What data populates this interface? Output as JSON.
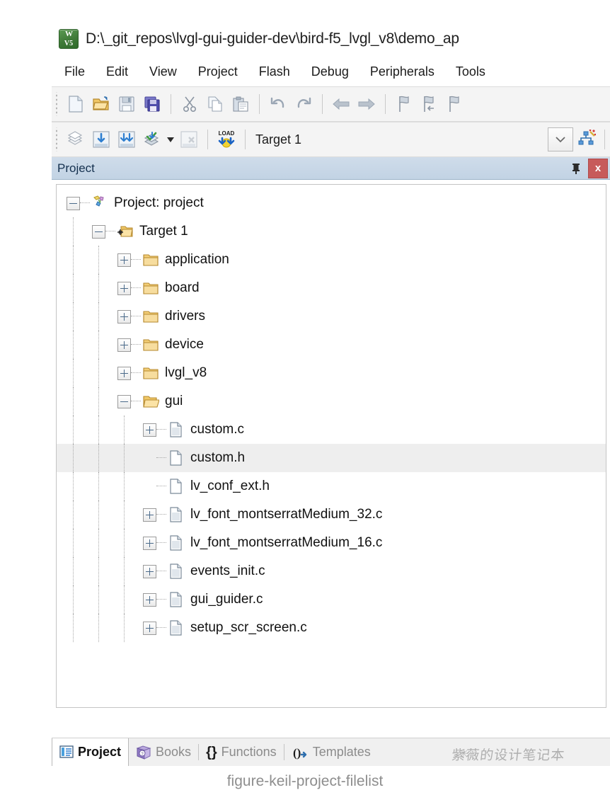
{
  "window": {
    "title": "D:\\_git_repos\\lvgl-gui-guider-dev\\bird-f5_lvgl_v8\\demo_ap",
    "app_icon": "keil-uvision-icon",
    "icon_top_text": "W",
    "icon_bottom_text": "V5"
  },
  "menu": {
    "items": [
      {
        "label": "File"
      },
      {
        "label": "Edit"
      },
      {
        "label": "View"
      },
      {
        "label": "Project"
      },
      {
        "label": "Flash"
      },
      {
        "label": "Debug"
      },
      {
        "label": "Peripherals"
      },
      {
        "label": "Tools"
      }
    ]
  },
  "toolbar_main": {
    "buttons": [
      {
        "name": "new-file-icon"
      },
      {
        "name": "open-file-icon"
      },
      {
        "name": "save-icon"
      },
      {
        "name": "save-all-icon"
      },
      {
        "name": "cut-icon"
      },
      {
        "name": "copy-icon"
      },
      {
        "name": "paste-icon"
      },
      {
        "name": "undo-icon"
      },
      {
        "name": "redo-icon"
      },
      {
        "name": "navigate-back-icon"
      },
      {
        "name": "navigate-forward-icon"
      },
      {
        "name": "bookmark-toggle-icon"
      },
      {
        "name": "bookmark-prev-icon"
      },
      {
        "name": "bookmark-next-icon"
      }
    ]
  },
  "toolbar_build": {
    "buttons": [
      {
        "name": "translate-icon"
      },
      {
        "name": "build-icon"
      },
      {
        "name": "rebuild-icon"
      },
      {
        "name": "batch-build-icon"
      },
      {
        "name": "stop-build-icon"
      },
      {
        "name": "download-icon"
      }
    ],
    "target_label": "Target 1",
    "dropdown_arrow": "chevron-down-icon",
    "manage_targets_icon": "manage-project-items-icon",
    "batch_dropdown_arrow": "caret-down-icon",
    "load_badge": "LOAD"
  },
  "pane": {
    "title": "Project",
    "pin_icon": "pin-icon",
    "close_icon": "close-icon",
    "close_label": "x"
  },
  "tree": {
    "nodes": [
      {
        "label": "Project: project",
        "depth": 0,
        "icon": "project-icon",
        "expander": "minus",
        "selected": false
      },
      {
        "label": "Target 1",
        "depth": 1,
        "icon": "target-icon",
        "expander": "minus",
        "selected": false
      },
      {
        "label": "application",
        "depth": 2,
        "icon": "folder-icon",
        "expander": "plus",
        "selected": false
      },
      {
        "label": "board",
        "depth": 2,
        "icon": "folder-icon",
        "expander": "plus",
        "selected": false
      },
      {
        "label": "drivers",
        "depth": 2,
        "icon": "folder-icon",
        "expander": "plus",
        "selected": false
      },
      {
        "label": "device",
        "depth": 2,
        "icon": "folder-icon",
        "expander": "plus",
        "selected": false
      },
      {
        "label": "lvgl_v8",
        "depth": 2,
        "icon": "folder-icon",
        "expander": "plus",
        "selected": false
      },
      {
        "label": "gui",
        "depth": 2,
        "icon": "folder-open-icon",
        "expander": "minus",
        "selected": false
      },
      {
        "label": "custom.c",
        "depth": 3,
        "icon": "c-file-icon",
        "expander": "plus",
        "selected": false
      },
      {
        "label": "custom.h",
        "depth": 3,
        "icon": "h-file-icon",
        "expander": "none",
        "selected": true
      },
      {
        "label": "lv_conf_ext.h",
        "depth": 3,
        "icon": "h-file-icon",
        "expander": "none",
        "selected": false
      },
      {
        "label": "lv_font_montserratMedium_32.c",
        "depth": 3,
        "icon": "c-file-icon",
        "expander": "plus",
        "selected": false
      },
      {
        "label": "lv_font_montserratMedium_16.c",
        "depth": 3,
        "icon": "c-file-icon",
        "expander": "plus",
        "selected": false
      },
      {
        "label": "events_init.c",
        "depth": 3,
        "icon": "c-file-icon",
        "expander": "plus",
        "selected": false
      },
      {
        "label": "gui_guider.c",
        "depth": 3,
        "icon": "c-file-icon",
        "expander": "plus",
        "selected": false
      },
      {
        "label": "setup_scr_screen.c",
        "depth": 3,
        "icon": "c-file-icon",
        "expander": "plus",
        "selected": false
      }
    ]
  },
  "tabs": {
    "items": [
      {
        "label": "Project",
        "icon": "project-tab-icon",
        "active": true
      },
      {
        "label": "Books",
        "icon": "books-tab-icon",
        "active": false
      },
      {
        "label": "Functions",
        "icon": "braces-icon",
        "active": false
      },
      {
        "label": "Templates",
        "icon": "templates-icon",
        "active": false
      }
    ]
  },
  "watermark": {
    "text": "紫薇的设计笔记本"
  },
  "caption": {
    "text": "figure-keil-project-filelist"
  },
  "colors": {
    "pane_header_start": "#cfdcea",
    "pane_header_end": "#c2d3e4",
    "close_red": "#c75b5b",
    "folder_yellow": "#f5cf76",
    "selection_gray": "#eeeeee",
    "toolbar_bg": "#f4f4f4",
    "caption_gray": "#8e8e8e"
  }
}
